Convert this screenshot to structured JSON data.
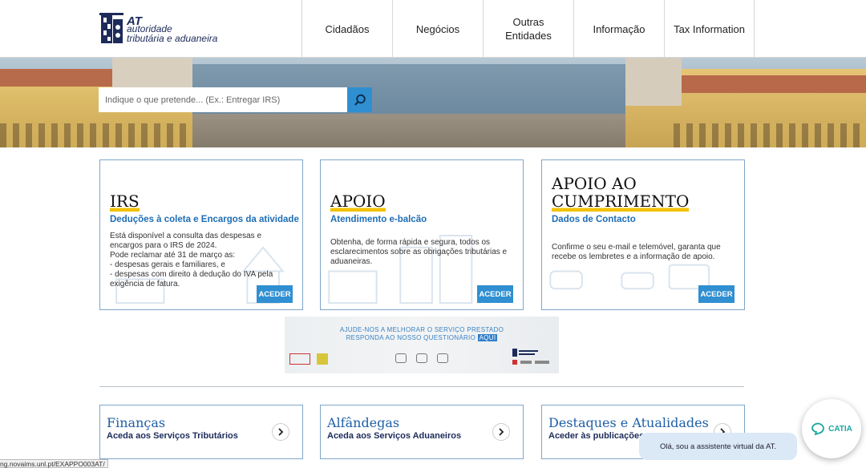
{
  "header": {
    "logo": {
      "line1": "AT",
      "line2": "autoridade",
      "line3": "tributária e aduaneira"
    },
    "nav": [
      {
        "label": "Cidadãos"
      },
      {
        "label": "Negócios"
      },
      {
        "label": "Outras Entidades"
      },
      {
        "label": "Informação"
      },
      {
        "label": "Tax Information"
      }
    ]
  },
  "search": {
    "placeholder": "Indique o que pretende... (Ex.: Entregar IRS)",
    "icon": "search-icon"
  },
  "cards": [
    {
      "title": "IRS",
      "subtitle": "Deduções à coleta e Encargos da atividade",
      "body": "Está disponível a consulta das despesas e encargos para o IRS de 2024.\nPode reclamar até 31 de março as:\n- despesas gerais e familiares, e\n- despesas com direito à dedução do IVA pela exigência de fatura.",
      "button": "ACEDER"
    },
    {
      "title": "APOIO",
      "subtitle": "Atendimento e-balcão",
      "body": "Obtenha, de forma rápida e segura, todos os esclarecimentos sobre as obrigações tributárias e aduaneiras.",
      "button": "ACEDER"
    },
    {
      "title_line1": "APOIO AO",
      "title_line2": "CUMPRIMENTO",
      "subtitle": "Dados de Contacto",
      "body": "Confirme o seu e-mail e telemóvel, garanta que recebe os lembretes e a informação de apoio.",
      "button": "ACEDER"
    }
  ],
  "survey_banner": {
    "line1": "AJUDE-NOS A MELHORAR O SERVIÇO PRESTADO",
    "line2": "RESPONDA AO NOSSO QUESTIONÁRIO",
    "highlight": "AQUI"
  },
  "bottom_cards": [
    {
      "title": "Finanças",
      "subtitle": "Aceda aos Serviços Tributários"
    },
    {
      "title": "Alfândegas",
      "subtitle": "Aceda aos Serviços Aduaneiros"
    },
    {
      "title": "Destaques e Atualidades",
      "subtitle": "Aceder às publicações"
    }
  ],
  "chat": {
    "message": "Olá, sou a assistente virtual da AT.",
    "button_label": "CATIA"
  },
  "status_url": "ng.novaims.unl.pt/EXAPPO003AT/",
  "colors": {
    "accent": "#2f8fd1",
    "underline": "#f2c200",
    "navy": "#1c2b5a"
  }
}
